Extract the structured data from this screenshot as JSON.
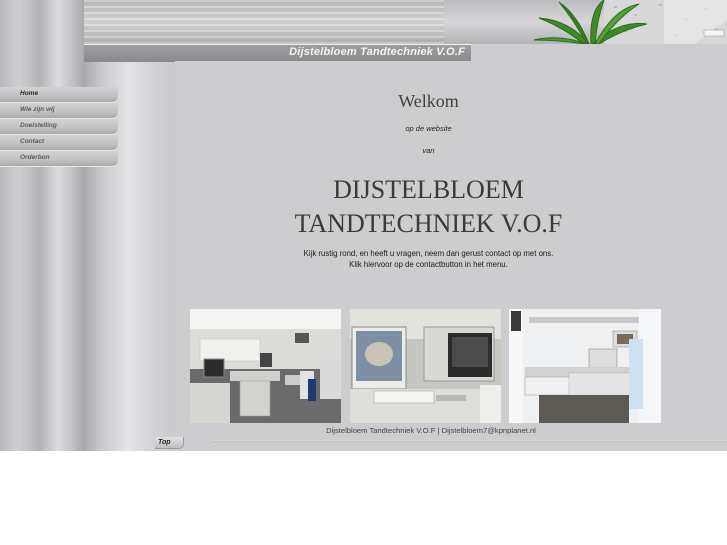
{
  "header": {
    "site_title": "Dijstelbloem Tandtechniek V.O.F"
  },
  "nav": {
    "items": [
      {
        "label": "Home",
        "active": true
      },
      {
        "label": "Wie zijn wij"
      },
      {
        "label": "Doelstelling"
      },
      {
        "label": "Contact"
      },
      {
        "label": "Orderbon"
      }
    ]
  },
  "main": {
    "welcome": "Welkom",
    "subtitle_1": "op de website",
    "subtitle_2": "van",
    "company_line_1": "DIJSTELBLOEM",
    "company_line_2": "TANDTECHNIEK V.O.F",
    "intro_line_1": "Kijk rustig rond, en heeft u vragen, neem dan gerust contact op met ons.",
    "intro_line_2": "Klik hiervoor op de contactbutton in het menu."
  },
  "footer": {
    "text": "Dijstelbloem Tandtechniek V.O.F | Dijstelbloem7@kpnplanet.nl"
  },
  "top_button": {
    "label": "Top"
  },
  "colors": {
    "background": "#cdcdcf",
    "title_bar": "#8f8f91",
    "heading_text": "#3a3a3a"
  }
}
